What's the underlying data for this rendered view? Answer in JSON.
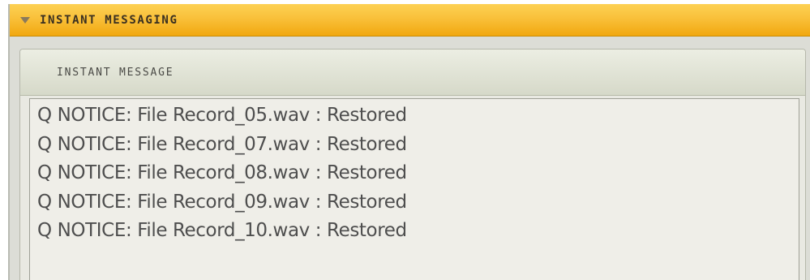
{
  "titlebar": {
    "label": "INSTANT MESSAGING",
    "icon": "triangle-down-icon"
  },
  "panel": {
    "header_label": "INSTANT MESSAGE"
  },
  "messages": [
    "Q NOTICE: File Record_05.wav : Restored",
    "Q NOTICE: File Record_07.wav : Restored",
    "Q NOTICE: File Record_08.wav : Restored",
    "Q NOTICE: File Record_09.wav : Restored",
    "Q NOTICE: File Record_10.wav : Restored"
  ],
  "colors": {
    "titlebar_accent": "#f9c03a",
    "text": "#4e4e4e"
  }
}
